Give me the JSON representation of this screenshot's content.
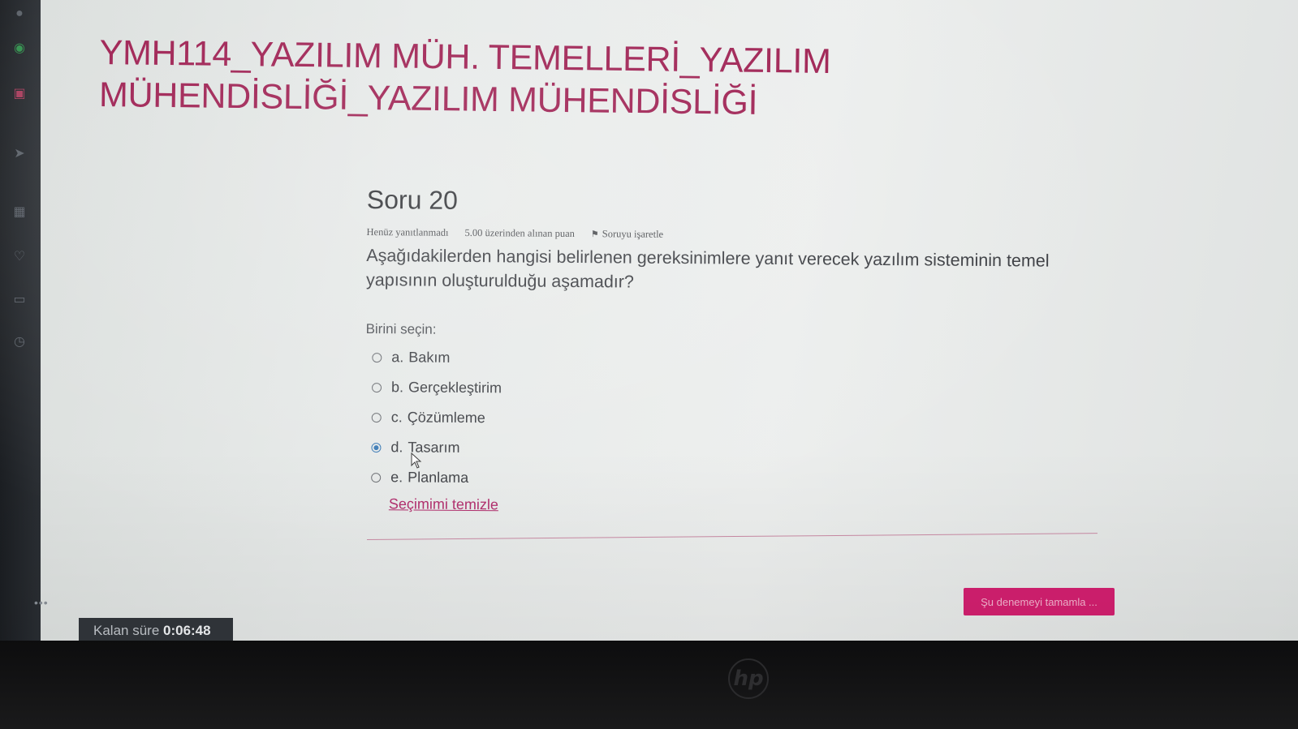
{
  "course": {
    "title": "YMH114_YAZILIM MÜH. TEMELLERİ_YAZILIM MÜHENDİSLİĞİ_YAZILIM MÜHENDİSLİĞİ"
  },
  "question": {
    "heading": "Soru 20",
    "status": "Henüz yanıtlanmadı",
    "points": "5.00 üzerinden alınan puan",
    "flag_label": "Soruyu işaretle",
    "text": "Aşağıdakilerden hangisi belirlenen gereksinimlere yanıt verecek yazılım sisteminin temel yapısının oluşturulduğu aşamadır?",
    "prompt": "Birini seçin:",
    "answers": [
      {
        "letter": "a.",
        "text": "Bakım",
        "selected": false
      },
      {
        "letter": "b.",
        "text": "Gerçekleştirim",
        "selected": false
      },
      {
        "letter": "c.",
        "text": "Çözümleme",
        "selected": false
      },
      {
        "letter": "d.",
        "text": "Tasarım",
        "selected": true
      },
      {
        "letter": "e.",
        "text": "Planlama",
        "selected": false
      }
    ],
    "clear_label": "Seçimimi temizle"
  },
  "finish_button": "Şu denemeyi tamamla ...",
  "timer": {
    "label": "Kalan süre",
    "value": "0:06:48"
  },
  "colors": {
    "accent": "#9c1b4e",
    "button": "#d21f6f",
    "link": "#b02a6a",
    "radio": "#3a79b5"
  }
}
